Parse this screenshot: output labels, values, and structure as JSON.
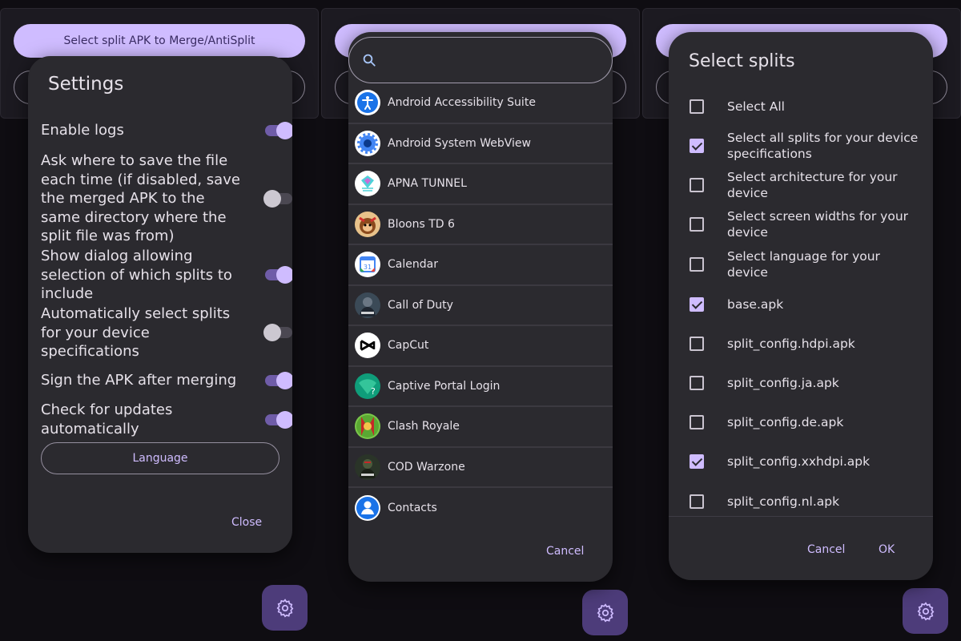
{
  "background": {
    "merge_button_label": "Select split APK to Merge/AntiSplit"
  },
  "settings": {
    "title": "Settings",
    "items": [
      {
        "label": "Enable logs",
        "enabled": true
      },
      {
        "label": "Ask where to save the file each time (if disabled, save the merged APK to the same directory where the split file was from)",
        "enabled": false
      },
      {
        "label": "Show dialog allowing selection of which splits to include",
        "enabled": true
      },
      {
        "label": "Automatically select splits for your device specifications",
        "enabled": false
      },
      {
        "label": "Sign the APK after merging",
        "enabled": true
      },
      {
        "label": "Check for updates automatically",
        "enabled": true
      }
    ],
    "language_button": "Language",
    "close_button": "Close"
  },
  "app_picker": {
    "search_placeholder": "",
    "apps": [
      {
        "name": "Android Accessibility Suite",
        "icon": "accessibility-icon"
      },
      {
        "name": "Android System WebView",
        "icon": "webview-gear-icon"
      },
      {
        "name": "APNA TUNNEL",
        "icon": "tunnel-icon"
      },
      {
        "name": "Bloons TD 6",
        "icon": "monkey-icon"
      },
      {
        "name": "Calendar",
        "icon": "calendar-icon"
      },
      {
        "name": "Call of Duty",
        "icon": "soldier-icon"
      },
      {
        "name": "CapCut",
        "icon": "capcut-icon"
      },
      {
        "name": "Captive Portal Login",
        "icon": "wifi-question-icon"
      },
      {
        "name": "Clash Royale",
        "icon": "clash-royale-icon"
      },
      {
        "name": "COD Warzone",
        "icon": "warzone-icon"
      },
      {
        "name": "Contacts",
        "icon": "person-icon"
      }
    ],
    "cancel_button": "Cancel"
  },
  "select_splits": {
    "title": "Select splits",
    "items": [
      {
        "label": "Select All",
        "checked": false
      },
      {
        "label": "Select all splits for your device specifications",
        "checked": true
      },
      {
        "label": "Select architecture for your device",
        "checked": false
      },
      {
        "label": "Select screen widths for your device",
        "checked": false
      },
      {
        "label": "Select language for your device",
        "checked": false
      },
      {
        "label": "base.apk",
        "checked": true
      },
      {
        "label": "split_config.hdpi.apk",
        "checked": false
      },
      {
        "label": "split_config.ja.apk",
        "checked": false
      },
      {
        "label": "split_config.de.apk",
        "checked": false
      },
      {
        "label": "split_config.xxhdpi.apk",
        "checked": true
      },
      {
        "label": "split_config.nl.apk",
        "checked": false
      }
    ],
    "cancel_button": "Cancel",
    "ok_button": "OK"
  },
  "colors": {
    "accent": "#cfbcff",
    "dialog_bg": "#2b2a2f",
    "page_bg": "#0f0d12",
    "fab_bg": "#4d3c7a"
  }
}
